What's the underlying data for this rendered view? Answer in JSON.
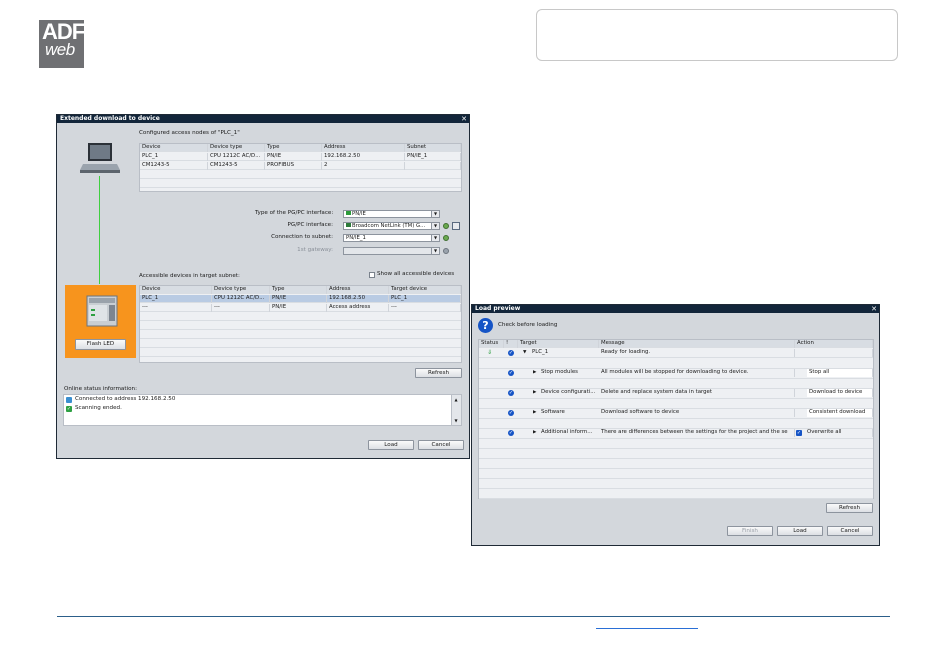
{
  "logo": {
    "line1": "ADF",
    "line2": "web"
  },
  "download_dialog": {
    "title": "Extended download to device",
    "close": "✕",
    "configured_title": "Configured access nodes of \"PLC_1\"",
    "configured_headers": [
      "Device",
      "Device type",
      "Type",
      "Address",
      "Subnet"
    ],
    "configured_rows": [
      [
        "PLC_1",
        "CPU 1212C AC/D...",
        "PN/IE",
        "192.168.2.50",
        "PN/IE_1"
      ],
      [
        "CM1243-5",
        "CM1243-5",
        "PROFIBUS",
        "2",
        ""
      ]
    ],
    "pgpc_type_label": "Type of the PG/PC interface:",
    "pgpc_type_value": "PN/IE",
    "pgpc_label": "PG/PC interface:",
    "pgpc_value": "Broadcom NetLink (TM) G...",
    "subnet_label": "Connection to subnet:",
    "subnet_value": "PN/IE_1",
    "gateway_label": "1st gateway:",
    "gateway_value": "",
    "accessible_title": "Accessible devices in target subnet:",
    "show_all_label": "Show all accessible devices",
    "accessible_headers": [
      "Device",
      "Device type",
      "Type",
      "Address",
      "Target device"
    ],
    "accessible_rows": [
      [
        "PLC_1",
        "CPU 1212C AC/D...",
        "PN/IE",
        "192.168.2.50",
        "PLC_1"
      ],
      [
        "---",
        "---",
        "PN/IE",
        "Access address",
        "---"
      ]
    ],
    "flash_led": "Flash LED",
    "refresh": "Refresh",
    "status_title": "Online status information:",
    "status_lines": [
      "Connected to address 192.168.2.50",
      "Scanning ended."
    ],
    "load": "Load",
    "cancel": "Cancel"
  },
  "load_preview": {
    "title": "Load preview",
    "close": "✕",
    "check_label": "Check before loading",
    "headers": [
      "Status",
      "!",
      "Target",
      "Message",
      "Action"
    ],
    "rows": [
      {
        "target": "PLC_1",
        "message": "Ready for loading.",
        "action": ""
      },
      {
        "target": "Stop modules",
        "message": "All modules will be stopped for downloading to device.",
        "action": "Stop all"
      },
      {
        "target": "Device configurati...",
        "message": "Delete and replace system data in target",
        "action": "Download to device"
      },
      {
        "target": "Software",
        "message": "Download software to device",
        "action": "Consistent download"
      },
      {
        "target": "Additional inform...",
        "message": "There are differences between the settings for the project and the se",
        "action": "Overwrite all"
      }
    ],
    "refresh": "Refresh",
    "finish": "Finish",
    "load": "Load",
    "cancel": "Cancel"
  }
}
